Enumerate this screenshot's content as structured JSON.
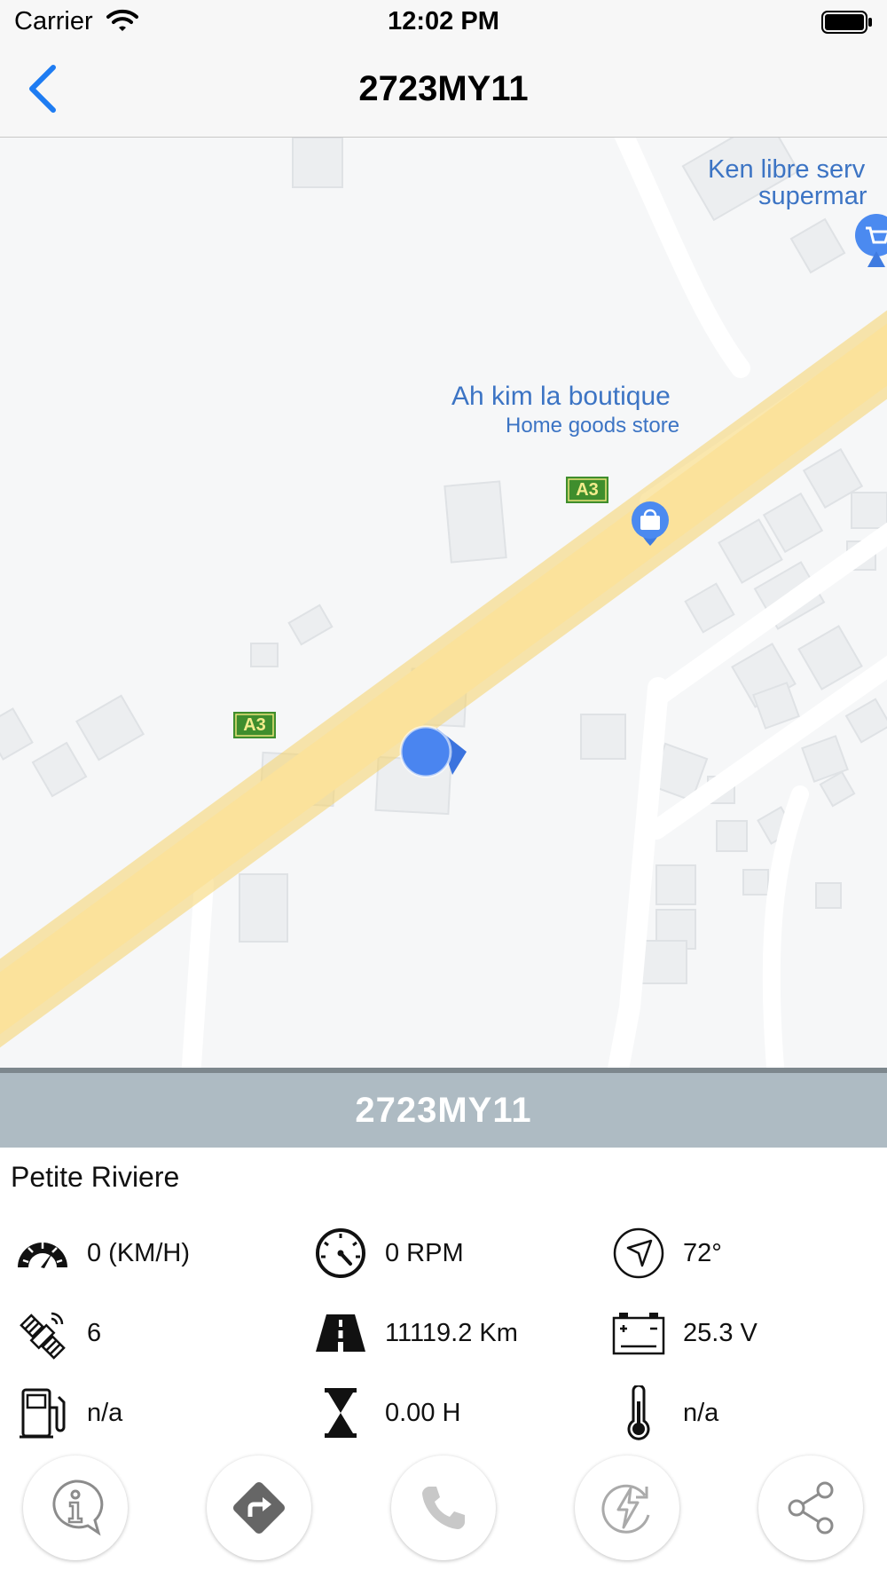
{
  "status_bar": {
    "carrier": "Carrier",
    "time": "12:02 PM"
  },
  "navbar": {
    "title": "2723MY11",
    "back_icon": "chevron-left-icon"
  },
  "map": {
    "road_label_1": "A3",
    "road_label_2": "A3",
    "poi_1_name": "Ah kim la boutique",
    "poi_1_category": "Home goods store",
    "poi_2_name_line1": "Ken libre serv",
    "poi_2_name_line2": "supermar"
  },
  "vehicle": {
    "plate": "2723MY11",
    "address": "Petite Riviere",
    "stats": {
      "speed": "0 (KM/H)",
      "rpm": "0 RPM",
      "heading": "72°",
      "satellites": "6",
      "odometer": "11119.2 Km",
      "voltage": "25.3 V",
      "fuel": "n/a",
      "engine_hours": "0.00 H",
      "temperature": "n/a"
    }
  },
  "actions": [
    "info-icon",
    "directions-icon",
    "phone-icon",
    "engine-cut-icon",
    "share-icon"
  ],
  "colors": {
    "accent": "#1e7cf2",
    "plate_bar": "#aebbc3",
    "road": "#fbe29b",
    "marker": "#4a85f0"
  }
}
